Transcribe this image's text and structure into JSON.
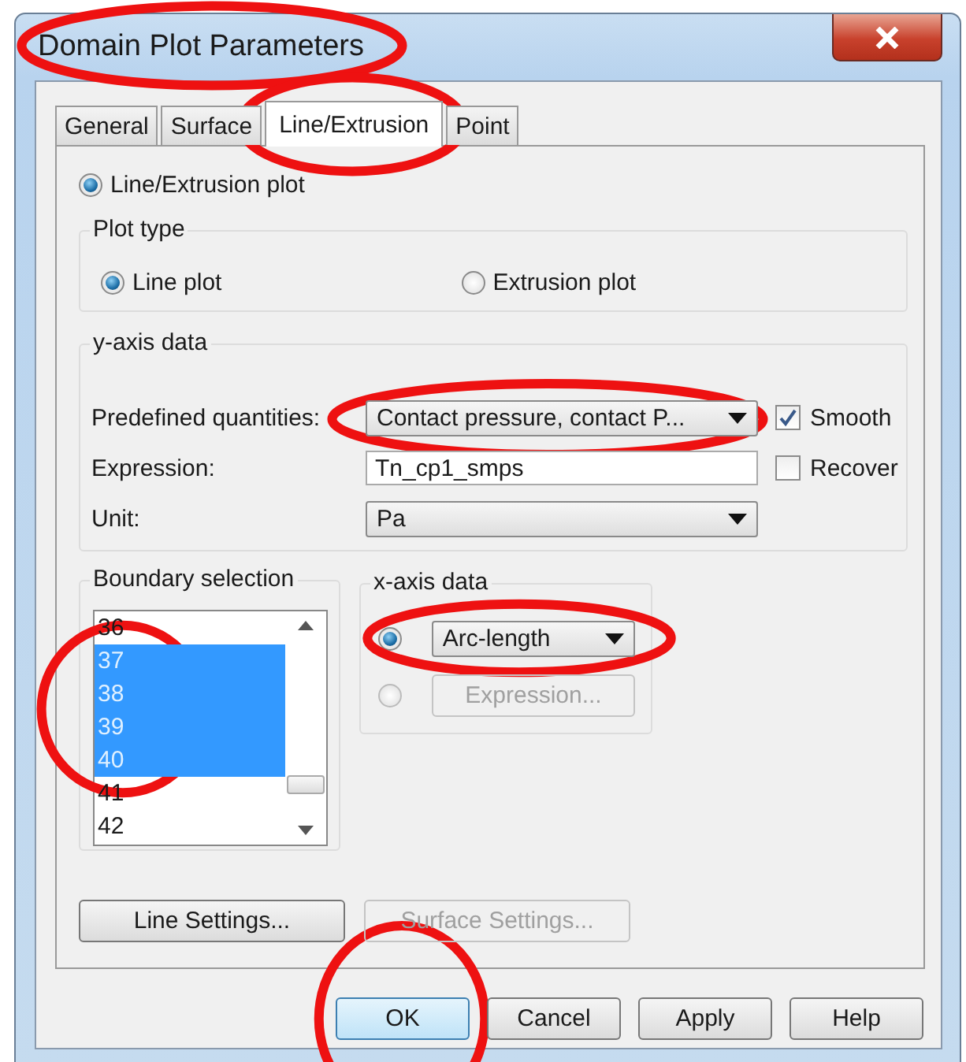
{
  "window": {
    "title": "Domain Plot Parameters",
    "circled": true
  },
  "tabs": [
    {
      "label": "General",
      "selected": false,
      "circled": false
    },
    {
      "label": "Surface",
      "selected": false,
      "circled": false
    },
    {
      "label": "Line/Extrusion",
      "selected": true,
      "circled": true
    },
    {
      "label": "Point",
      "selected": false,
      "circled": false
    }
  ],
  "plot_option": {
    "label": "Line/Extrusion plot",
    "selected": true
  },
  "plot_type": {
    "title": "Plot type",
    "options": [
      {
        "label": "Line plot",
        "selected": true
      },
      {
        "label": "Extrusion plot",
        "selected": false
      }
    ]
  },
  "y_axis": {
    "title": "y-axis data",
    "rows": [
      {
        "label": "Predefined quantities:",
        "kind": "dropdown",
        "value": "Contact pressure, contact P...",
        "circled": true,
        "checkbox": {
          "label": "Smooth",
          "checked": true
        }
      },
      {
        "label": "Expression:",
        "kind": "text",
        "value": "Tn_cp1_smps",
        "circled": false,
        "checkbox": {
          "label": "Recover",
          "checked": false
        }
      },
      {
        "label": "Unit:",
        "kind": "dropdown",
        "value": "Pa",
        "circled": false
      }
    ]
  },
  "boundary_selection": {
    "title": "Boundary selection",
    "circled": true,
    "items": [
      {
        "label": "36",
        "selected": false
      },
      {
        "label": "37",
        "selected": true
      },
      {
        "label": "38",
        "selected": true
      },
      {
        "label": "39",
        "selected": true
      },
      {
        "label": "40",
        "selected": true
      },
      {
        "label": "41",
        "selected": false
      },
      {
        "label": "42",
        "selected": false
      }
    ]
  },
  "x_axis": {
    "title": "x-axis data",
    "options": [
      {
        "kind": "dropdown",
        "value": "Arc-length",
        "selected": true,
        "disabled": false,
        "circled": true
      },
      {
        "kind": "button",
        "value": "Expression...",
        "selected": false,
        "disabled": true,
        "circled": false
      }
    ]
  },
  "settings_buttons": [
    {
      "label": "Line Settings...",
      "disabled": false,
      "circled": false
    },
    {
      "label": "Surface Settings...",
      "disabled": true,
      "circled": false
    }
  ],
  "buttons": [
    {
      "label": "OK",
      "default": true,
      "circled": true
    },
    {
      "label": "Cancel",
      "default": false,
      "circled": false
    },
    {
      "label": "Apply",
      "default": false,
      "circled": false
    },
    {
      "label": "Help",
      "default": false,
      "circled": false
    }
  ]
}
